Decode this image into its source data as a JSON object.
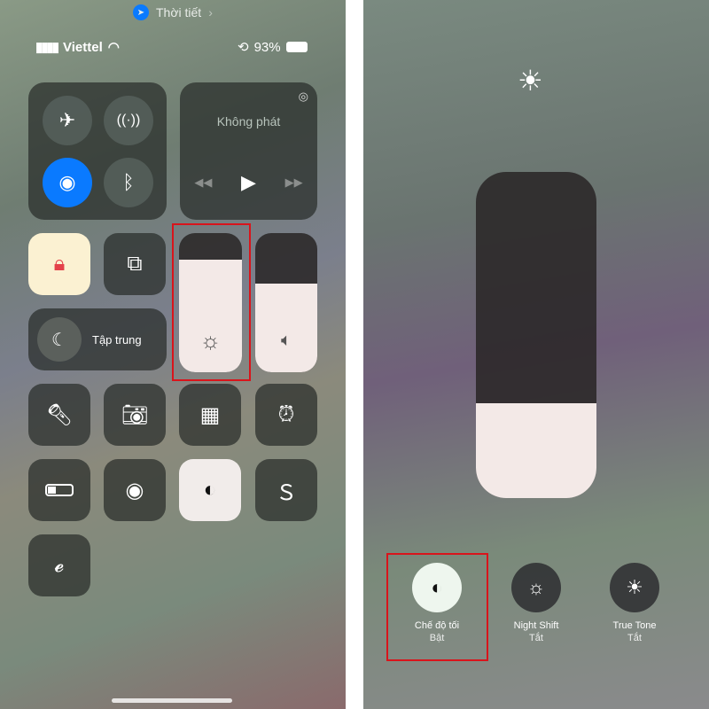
{
  "left": {
    "weather_link": "Thời tiết",
    "status": {
      "carrier": "Viettel",
      "battery": "93%"
    },
    "connectivity": {
      "airplane": "off",
      "cellular": "off",
      "wifi": "on",
      "bluetooth": "off"
    },
    "media": {
      "title": "Không phát"
    },
    "focus": {
      "label": "Tập trung"
    },
    "brightness_level": 0.81,
    "volume_level": 0.64,
    "icons": [
      "airplane-icon",
      "cellular-icon",
      "wifi-icon",
      "bluetooth-icon",
      "airplay-icon",
      "rewind-icon",
      "play-icon",
      "forward-icon",
      "rotation-lock-icon",
      "screen-mirroring-icon",
      "moon-icon",
      "sun-icon",
      "speaker-icon",
      "flashlight-icon",
      "camera-icon",
      "calculator-icon",
      "alarm-icon",
      "battery-icon",
      "screen-record-icon",
      "dark-mode-icon",
      "shazam-icon",
      "hearing-icon"
    ]
  },
  "right": {
    "brightness_level": 0.29,
    "buttons": [
      {
        "label": "Chế độ tối",
        "status": "Bật",
        "icon": "dark-mode-icon"
      },
      {
        "label": "Night Shift",
        "status": "Tắt",
        "icon": "night-shift-icon"
      },
      {
        "label": "True Tone",
        "status": "Tắt",
        "icon": "true-tone-icon"
      }
    ]
  },
  "colors": {
    "accent": "#0a7aff",
    "highlight": "#d9141b"
  }
}
